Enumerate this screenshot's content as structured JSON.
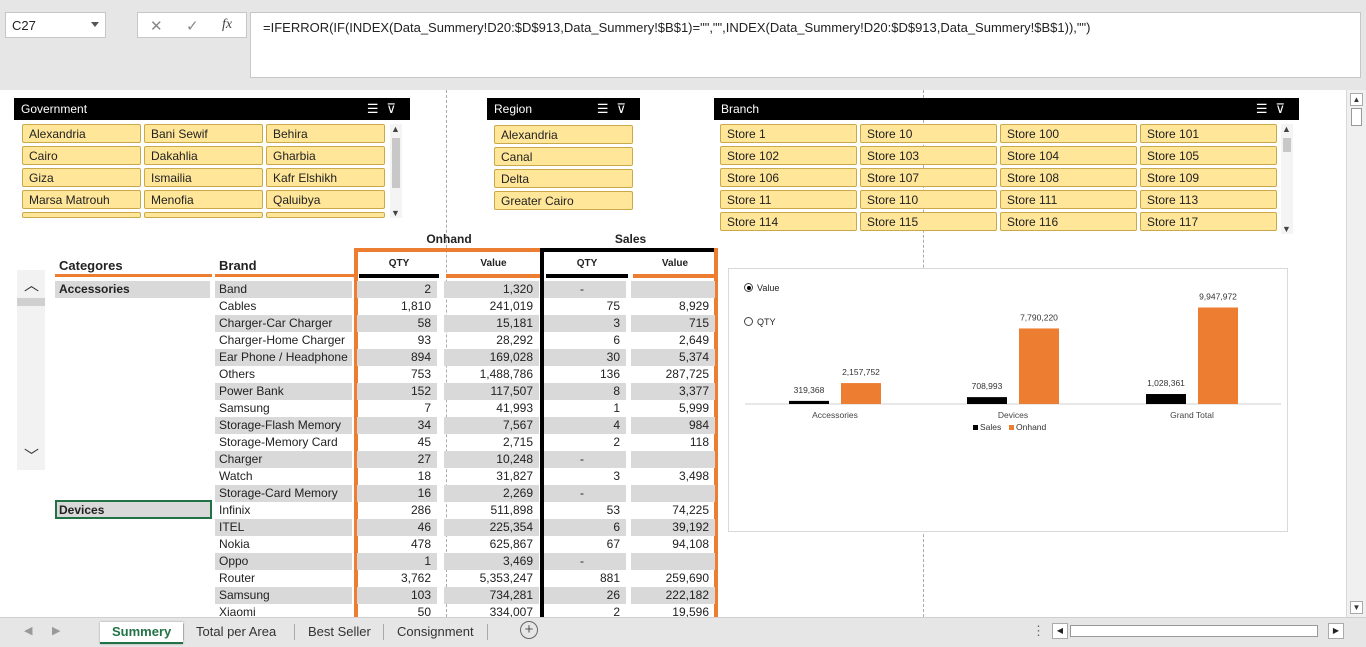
{
  "formula_bar": {
    "name_box": "C27",
    "cancel_glyph": "✕",
    "enter_glyph": "✓",
    "fx_label": "fx",
    "formula": "=IFERROR(IF(INDEX(Data_Summery!D20:$D$913,Data_Summery!$B$1)=\"\",\"\",INDEX(Data_Summery!D20:$D$913,Data_Summery!$B$1)),\"\")"
  },
  "slicers": {
    "government": {
      "title": "Government",
      "items": [
        "Alexandria",
        "Bani Sewif",
        "Behira",
        "Cairo",
        "Dakahlia",
        "Gharbia",
        "Giza",
        "Ismailia",
        "Kafr Elshikh",
        "Marsa Matrouh",
        "Menofia",
        "Qaluibya",
        "",
        "",
        ""
      ]
    },
    "region": {
      "title": "Region",
      "items": [
        "Alexandria",
        "Canal",
        "Delta",
        "Greater Cairo"
      ]
    },
    "branch": {
      "title": "Branch",
      "items": [
        "Store 1",
        "Store 10",
        "Store 100",
        "Store 101",
        "Store 102",
        "Store 103",
        "Store 104",
        "Store 105",
        "Store 106",
        "Store 107",
        "Store 108",
        "Store 109",
        "Store 11",
        "Store 110",
        "Store 111",
        "Store 113",
        "Store 114",
        "Store 115",
        "Store 116",
        "Store 117"
      ]
    }
  },
  "table": {
    "group_onhand": "Onhand",
    "group_sales": "Sales",
    "col_category": "Categores",
    "col_brand": "Brand",
    "col_qty": "QTY",
    "col_value": "Value",
    "rows": [
      {
        "cat": "Accessories",
        "brand": "Band",
        "oq": "2",
        "ov": "1,320",
        "sq": "-",
        "sv": ""
      },
      {
        "cat": "",
        "brand": "Cables",
        "oq": "1,810",
        "ov": "241,019",
        "sq": "75",
        "sv": "8,929"
      },
      {
        "cat": "",
        "brand": "Charger-Car Charger",
        "oq": "58",
        "ov": "15,181",
        "sq": "3",
        "sv": "715"
      },
      {
        "cat": "",
        "brand": "Charger-Home Charger",
        "oq": "93",
        "ov": "28,292",
        "sq": "6",
        "sv": "2,649"
      },
      {
        "cat": "",
        "brand": "Ear Phone / Headphone",
        "oq": "894",
        "ov": "169,028",
        "sq": "30",
        "sv": "5,374"
      },
      {
        "cat": "",
        "brand": "Others",
        "oq": "753",
        "ov": "1,488,786",
        "sq": "136",
        "sv": "287,725"
      },
      {
        "cat": "",
        "brand": "Power Bank",
        "oq": "152",
        "ov": "117,507",
        "sq": "8",
        "sv": "3,377"
      },
      {
        "cat": "",
        "brand": "Samsung",
        "oq": "7",
        "ov": "41,993",
        "sq": "1",
        "sv": "5,999"
      },
      {
        "cat": "",
        "brand": "Storage-Flash Memory",
        "oq": "34",
        "ov": "7,567",
        "sq": "4",
        "sv": "984"
      },
      {
        "cat": "",
        "brand": "Storage-Memory Card",
        "oq": "45",
        "ov": "2,715",
        "sq": "2",
        "sv": "118"
      },
      {
        "cat": "",
        "brand": "Charger",
        "oq": "27",
        "ov": "10,248",
        "sq": "-",
        "sv": ""
      },
      {
        "cat": "",
        "brand": "Watch",
        "oq": "18",
        "ov": "31,827",
        "sq": "3",
        "sv": "3,498"
      },
      {
        "cat": "",
        "brand": "Storage-Card Memory",
        "oq": "16",
        "ov": "2,269",
        "sq": "-",
        "sv": ""
      },
      {
        "cat": "Devices",
        "brand": "Infinix",
        "oq": "286",
        "ov": "511,898",
        "sq": "53",
        "sv": "74,225"
      },
      {
        "cat": "",
        "brand": "ITEL",
        "oq": "46",
        "ov": "225,354",
        "sq": "6",
        "sv": "39,192"
      },
      {
        "cat": "",
        "brand": "Nokia",
        "oq": "478",
        "ov": "625,867",
        "sq": "67",
        "sv": "94,108"
      },
      {
        "cat": "",
        "brand": "Oppo",
        "oq": "1",
        "ov": "3,469",
        "sq": "-",
        "sv": ""
      },
      {
        "cat": "",
        "brand": "Router",
        "oq": "3,762",
        "ov": "5,353,247",
        "sq": "881",
        "sv": "259,690"
      },
      {
        "cat": "",
        "brand": "Samsung",
        "oq": "103",
        "ov": "734,281",
        "sq": "26",
        "sv": "222,182"
      },
      {
        "cat": "",
        "brand": "Xiaomi",
        "oq": "50",
        "ov": "334,007",
        "sq": "2",
        "sv": "19,596"
      }
    ]
  },
  "chart_options": {
    "value_label": "Value",
    "qty_label": "QTY",
    "selected": "Value"
  },
  "chart_data": {
    "type": "bar",
    "categories": [
      "Accessories",
      "Devices",
      "Grand Total"
    ],
    "series": [
      {
        "name": "Sales",
        "values": [
          319368,
          708993,
          1028361
        ],
        "labels": [
          "319,368",
          "708,993",
          "1,028,361"
        ],
        "color": "#000000"
      },
      {
        "name": "Onhand",
        "values": [
          2157752,
          7790220,
          9947972
        ],
        "labels": [
          "2,157,752",
          "7,790,220",
          "9,947,972"
        ],
        "color": "#ed7d31"
      }
    ],
    "ylim": [
      0,
      10000000
    ],
    "legend": "bottom",
    "grid": false
  },
  "tabs": [
    "Summery",
    "Total per Area",
    "Best Seller",
    "Consignment"
  ],
  "active_tab": "Summery",
  "colors": {
    "accent_orange": "#ed7d31",
    "slicer_item": "#ffe699",
    "header_black": "#000000",
    "excel_green": "#217346"
  }
}
